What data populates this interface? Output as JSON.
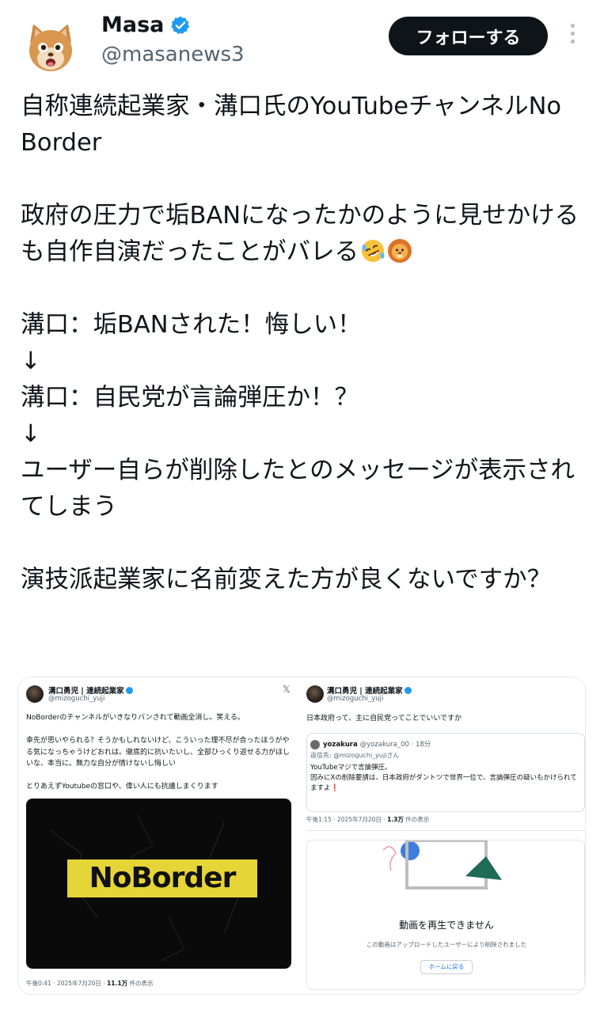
{
  "author": {
    "display_name": "Masa",
    "handle": "@masanews3",
    "avatar_icon": "cat-avatar-icon",
    "verified": true
  },
  "follow_button": "フォローする",
  "tweet_text": "自称連続起業家・溝口氏のYouTubeチャンネルNo Border\n\n政府の圧力で垢BANになったかのように見せかけるも自作自演だったことがバレる",
  "tweet_text_emoji": [
    "rolling-on-floor-laughing-emoji",
    "lion-face-emoji"
  ],
  "tweet_text_2": "溝口：垢BANされた！悔しい！\n↓\n溝口：自民党が言論弾圧か！？\n↓\nユーザー自らが削除したとのメッセージが表示されてしまう\n\n演技派起業家に名前変えた方が良くないですか？",
  "media": {
    "left": {
      "name": "溝口勇児 | 連続起業家",
      "handle": "@mizoguchi_yuji",
      "text": "NoBorderのチャンネルがいきなりバンされて動画全消し。笑える。\n\n幸先が思いやられる？そうかもしれないけど、こういった理不尽が合ったほうがやる気になっちゃうけどおれは。徹底的に抗いたいし、全部ひっくり返せる力がほしいな、本当に。無力な自分が情けないし悔しい\n\nとりあえずYoutubeの窓口や、偉い人にも抗議しまくります",
      "video_logo": "NoBorder",
      "meta_time": "午後0:41 · 2025年7月20日 · ",
      "meta_views": "11.1万",
      "meta_suffix": " 件の表示"
    },
    "right": {
      "name": "溝口勇児 | 連続起業家",
      "handle": "@mizoguchi_yuji",
      "text": "日本政府って、主に自民党ってことでいいですか",
      "quote_name": "yozakura",
      "quote_handle": "@yozakura_00 · 18分",
      "quote_reply": "返信先: @mizoguchi_yujiさん",
      "quote_text": "YouTubeマジで言論弾圧。\n因みにXの削除要請は、日本政府がダントツで世界一位で、言論弾圧の疑いもかけられてますよ❗️",
      "meta_time": "午後1:15 · 2025年7月20日 · ",
      "meta_views": "1.3万",
      "meta_suffix": " 件の表示",
      "unavailable_title": "動画を再生できません",
      "unavailable_sub": "この動画はアップロードしたユーザーにより削除されました",
      "home_button": "ホームに戻る"
    }
  },
  "colors": {
    "verified_blue": "#1d9bf0",
    "follow_bg": "#0f1419",
    "handle_gray": "#536471",
    "noborder_yellow": "#e6d536"
  }
}
